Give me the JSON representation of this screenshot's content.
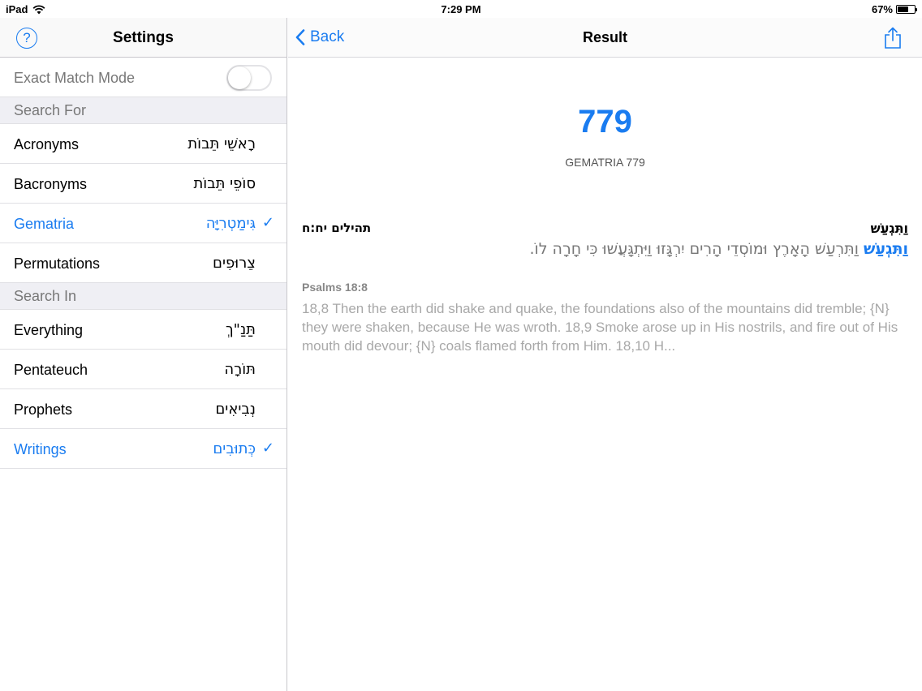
{
  "status": {
    "carrier": "iPad",
    "time": "7:29 PM",
    "battery": "67%",
    "battery_level": 0.67
  },
  "settings": {
    "title": "Settings",
    "help_glyph": "?",
    "exact_match": {
      "label": "Exact Match Mode",
      "on": false
    },
    "search_for_header": "Search For",
    "search_for": [
      {
        "label": "Acronyms",
        "hebrew": "רָאשֵׁי תֵּבוֹת",
        "selected": false
      },
      {
        "label": "Bacronyms",
        "hebrew": "סוֹפֵי תֵּבוֹת",
        "selected": false
      },
      {
        "label": "Gematria",
        "hebrew": "גִּימַטְרִיָּה",
        "selected": true
      },
      {
        "label": "Permutations",
        "hebrew": "צֵרוּפִים",
        "selected": false
      }
    ],
    "search_in_header": "Search In",
    "search_in": [
      {
        "label": "Everything",
        "hebrew": "תַּנַ\"ךְ",
        "selected": false
      },
      {
        "label": "Pentateuch",
        "hebrew": "תּוֹרָה",
        "selected": false
      },
      {
        "label": "Prophets",
        "hebrew": "נְבִיאִים",
        "selected": false
      },
      {
        "label": "Writings",
        "hebrew": "כְּתוּבִים",
        "selected": true
      }
    ],
    "check_glyph": "✓"
  },
  "result": {
    "back_label": "Back",
    "title": "Result",
    "number": "779",
    "gematria_label": "GEMATRIA 779",
    "verse": {
      "word": "וַתִּגְעַשׁ",
      "ref_hebrew": "תהילים יח:ח",
      "highlight": "וַתִּגְעַשׁ",
      "rest": " וַתִּרְעַשׁ הָאָרֶץ וּמוֹסְדֵי הָרִים יִרְגָּזוּ וַיִּתְגָּעֲשׁוּ כִּי חָרָה לוֹ.",
      "ref_english": "Psalms 18:8",
      "translation": "18,8 Then the earth did shake and quake, the foundations also of the mountains did tremble; {N} they were shaken, because He was wroth. 18,9 Smoke arose up in His nostrils, and fire out of His mouth did devour; {N} coals flamed forth from Him. 18,10 H..."
    }
  }
}
